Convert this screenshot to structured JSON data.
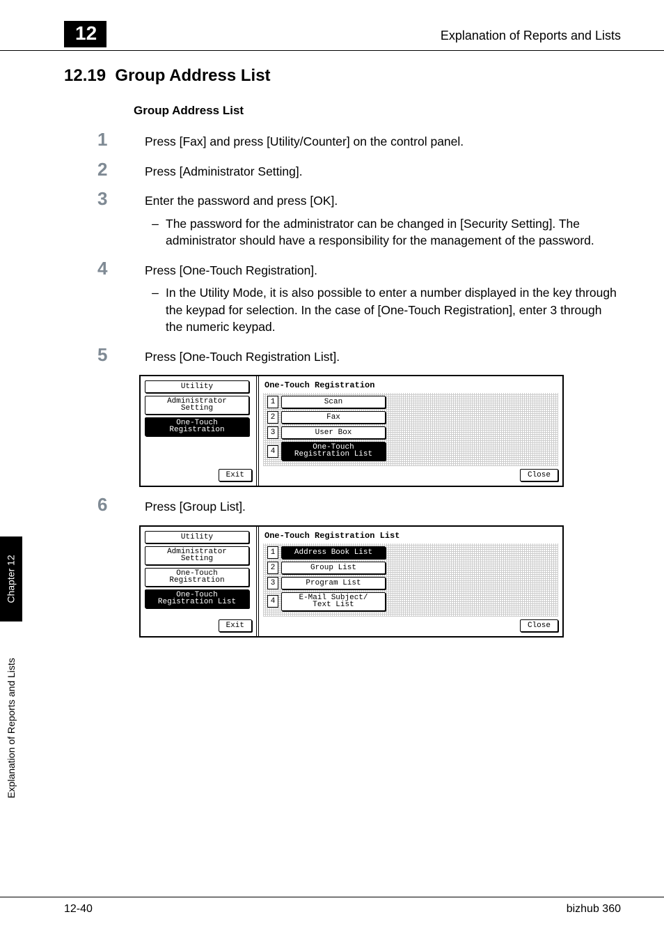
{
  "header": {
    "chapter_number": "12",
    "running_title": "Explanation of Reports and Lists"
  },
  "section": {
    "number": "12.19",
    "title": "Group Address List"
  },
  "subhead": "Group Address List",
  "steps": [
    {
      "n": "1",
      "text": "Press [Fax] and press [Utility/Counter] on the control panel."
    },
    {
      "n": "2",
      "text": "Press [Administrator Setting]."
    },
    {
      "n": "3",
      "text": "Enter the password and press [OK].",
      "sub": "The password for the administrator can be changed in [Security Setting]. The administrator should have a responsibility for the management of the password."
    },
    {
      "n": "4",
      "text": "Press [One-Touch Registration].",
      "sub": "In the Utility Mode, it is also possible to enter a number displayed in the key through the keypad for selection. In the case of [One-Touch Registration], enter 3 through the numeric keypad."
    },
    {
      "n": "5",
      "text": "Press [One-Touch Registration List]."
    },
    {
      "n": "6",
      "text": "Press [Group List]."
    }
  ],
  "screenshot1": {
    "title": "One-Touch Registration",
    "breadcrumbs": [
      {
        "label": "Utility",
        "selected": false
      },
      {
        "label": "Administrator\nSetting",
        "selected": false
      },
      {
        "label": "One-Touch\nRegistration",
        "selected": true
      }
    ],
    "items": [
      {
        "n": "1",
        "label": "Scan",
        "selected": false
      },
      {
        "n": "2",
        "label": "Fax",
        "selected": false
      },
      {
        "n": "3",
        "label": "User Box",
        "selected": false
      },
      {
        "n": "4",
        "label": "One-Touch\nRegistration List",
        "selected": true
      }
    ],
    "exit": "Exit",
    "close": "Close"
  },
  "screenshot2": {
    "title": "One-Touch Registration List",
    "breadcrumbs": [
      {
        "label": "Utility",
        "selected": false
      },
      {
        "label": "Administrator\nSetting",
        "selected": false
      },
      {
        "label": "One-Touch\nRegistration",
        "selected": false
      },
      {
        "label": "One-Touch\nRegistration List",
        "selected": true
      }
    ],
    "items": [
      {
        "n": "1",
        "label": "Address Book List",
        "selected": true
      },
      {
        "n": "2",
        "label": "Group List",
        "selected": false
      },
      {
        "n": "3",
        "label": "Program List",
        "selected": false
      },
      {
        "n": "4",
        "label": "E-Mail Subject/\nText List",
        "selected": false
      }
    ],
    "exit": "Exit",
    "close": "Close"
  },
  "side_tab": {
    "chapter": "Chapter 12",
    "title": "Explanation of Reports and Lists"
  },
  "footer": {
    "page": "12-40",
    "product": "bizhub 360"
  }
}
